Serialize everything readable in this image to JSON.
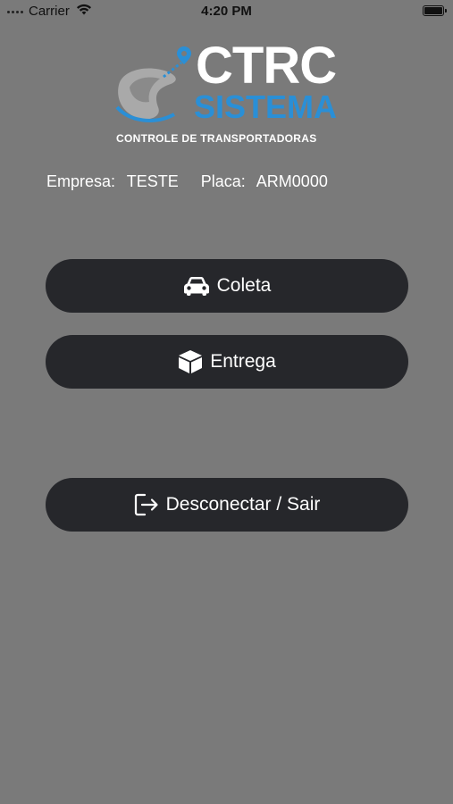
{
  "status_bar": {
    "carrier": "Carrier",
    "time": "4:20 PM"
  },
  "logo": {
    "title": "CTRC",
    "subtitle": "SISTEMA",
    "tagline": "CONTROLE DE TRANSPORTADORAS",
    "brand_blue": "#2a8fd6"
  },
  "info": {
    "empresa_label": "Empresa:",
    "empresa_value": "TESTE",
    "placa_label": "Placa:",
    "placa_value": "ARM0000"
  },
  "buttons": {
    "coleta": {
      "label": "Coleta",
      "icon": "car-icon"
    },
    "entrega": {
      "label": "Entrega",
      "icon": "box-icon"
    },
    "sair": {
      "label": "Desconectar / Sair",
      "icon": "logout-icon"
    }
  },
  "colors": {
    "background": "#7a7a7a",
    "button": "#26272b"
  }
}
